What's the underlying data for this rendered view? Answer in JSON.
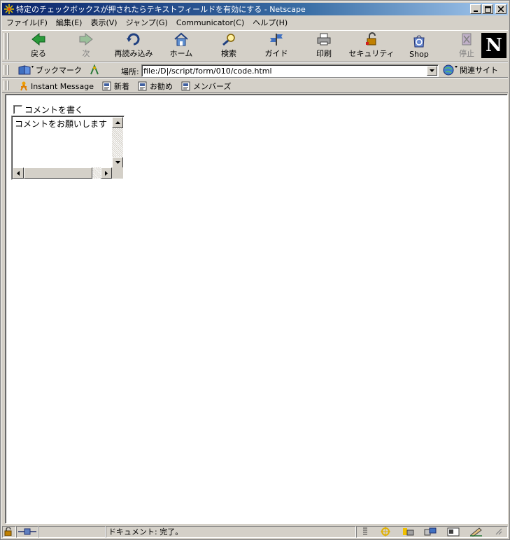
{
  "window": {
    "title": "特定のチェックボックスが押されたらテキストフィールドを有効にする - Netscape"
  },
  "menu": [
    {
      "label": "ファイル(F)"
    },
    {
      "label": "編集(E)"
    },
    {
      "label": "表示(V)"
    },
    {
      "label": "ジャンプ(G)"
    },
    {
      "label": "Communicator(C)"
    },
    {
      "label": "ヘルプ(H)"
    }
  ],
  "nav_toolbar": [
    {
      "label": "戻る",
      "icon": "back-arrow-icon",
      "enabled": true
    },
    {
      "label": "次",
      "icon": "forward-arrow-icon",
      "enabled": false
    },
    {
      "label": "再読み込み",
      "icon": "reload-icon",
      "enabled": true
    },
    {
      "label": "ホーム",
      "icon": "home-icon",
      "enabled": true
    },
    {
      "label": "検索",
      "icon": "search-icon",
      "enabled": true
    },
    {
      "label": "ガイド",
      "icon": "guide-icon",
      "enabled": true
    },
    {
      "label": "印刷",
      "icon": "print-icon",
      "enabled": true
    },
    {
      "label": "セキュリティ",
      "icon": "security-lock-icon",
      "enabled": true
    },
    {
      "label": "Shop",
      "icon": "shop-icon",
      "enabled": true
    },
    {
      "label": "停止",
      "icon": "stop-icon",
      "enabled": false
    }
  ],
  "location_bar": {
    "bookmarks_label": "ブックマーク",
    "location_label": "場所:",
    "url": "file:/D|/script/form/010/code.html",
    "related_label": "関連サイト"
  },
  "personal_toolbar": [
    {
      "label": "Instant Message",
      "icon": "instant-message-icon"
    },
    {
      "label": "新着",
      "icon": "bookmark-page-icon"
    },
    {
      "label": "お勧め",
      "icon": "bookmark-page-icon"
    },
    {
      "label": "メンバーズ",
      "icon": "bookmark-page-icon"
    }
  ],
  "page": {
    "checkbox_label": "コメントを書く",
    "checkbox_checked": false,
    "textarea_value": "コメントをお願いします"
  },
  "status": {
    "text": "ドキュメント: 完了。"
  },
  "colors": {
    "chrome": "#d4d0c8",
    "titlebar_start": "#0a246a",
    "titlebar_end": "#a6caf0"
  }
}
